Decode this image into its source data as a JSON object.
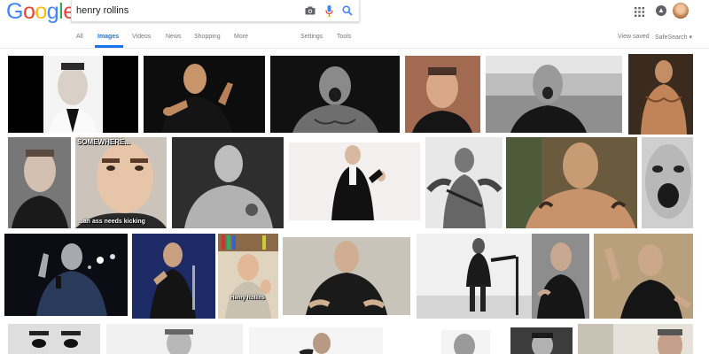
{
  "header": {
    "logo_letters": [
      {
        "char": "G",
        "color": "#4285F4"
      },
      {
        "char": "o",
        "color": "#EA4335"
      },
      {
        "char": "o",
        "color": "#FBBC05"
      },
      {
        "char": "g",
        "color": "#4285F4"
      },
      {
        "char": "l",
        "color": "#34A853"
      },
      {
        "char": "e",
        "color": "#EA4335"
      }
    ],
    "search_value": "henry rollins",
    "icons": {
      "camera": "camera-icon",
      "mic": "microphone-icon",
      "search": "search-icon",
      "apps": "apps-grid-icon",
      "notifications": "notifications-icon",
      "avatar": "avatar"
    }
  },
  "tabs": {
    "all": "All",
    "images": "Images",
    "videos": "Videos",
    "news": "News",
    "shopping": "Shopping",
    "more": "More",
    "settings": "Settings",
    "tools": "Tools",
    "view_saved": "View saved",
    "safesearch": "SafeSearch ▾"
  },
  "colors": {
    "accent": "#1a73e8",
    "tab_text": "#777777"
  },
  "results": {
    "captions": {
      "meme_top": "SOMEWHERE...",
      "meme_bottom": "...an ass needs kicking",
      "book_caption": "Henry Rollins"
    }
  }
}
